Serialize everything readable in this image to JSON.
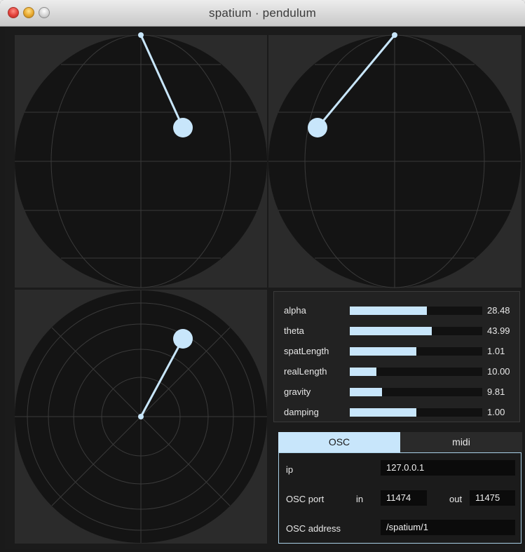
{
  "window": {
    "title": "spatium · pendulum"
  },
  "colors": {
    "background": "#1b1b1b",
    "sphere": "#141414",
    "grid": "#3a3a3a",
    "accent": "#c8e6fb"
  },
  "parameters": [
    {
      "label": "alpha",
      "value": "28.48",
      "fill_fraction": 0.58
    },
    {
      "label": "theta",
      "value": "43.99",
      "fill_fraction": 0.62
    },
    {
      "label": "spatLength",
      "value": "1.01",
      "fill_fraction": 0.5
    },
    {
      "label": "realLength",
      "value": "10.00",
      "fill_fraction": 0.2
    },
    {
      "label": "gravity",
      "value": "9.81",
      "fill_fraction": 0.245
    },
    {
      "label": "damping",
      "value": "1.00",
      "fill_fraction": 0.5
    }
  ],
  "tabs": [
    {
      "label": "OSC",
      "active": true
    },
    {
      "label": "midi",
      "active": false
    }
  ],
  "osc": {
    "ip_label": "ip",
    "ip_value": "127.0.0.1",
    "port_label": "OSC port",
    "in_label": "in",
    "in_value": "11474",
    "out_label": "out",
    "out_value": "11475",
    "address_label": "OSC address",
    "address_value": "/spatium/1"
  },
  "icons": {
    "close": "close-traffic-light",
    "minimize": "minimize-traffic-light",
    "zoom": "zoom-traffic-light"
  }
}
